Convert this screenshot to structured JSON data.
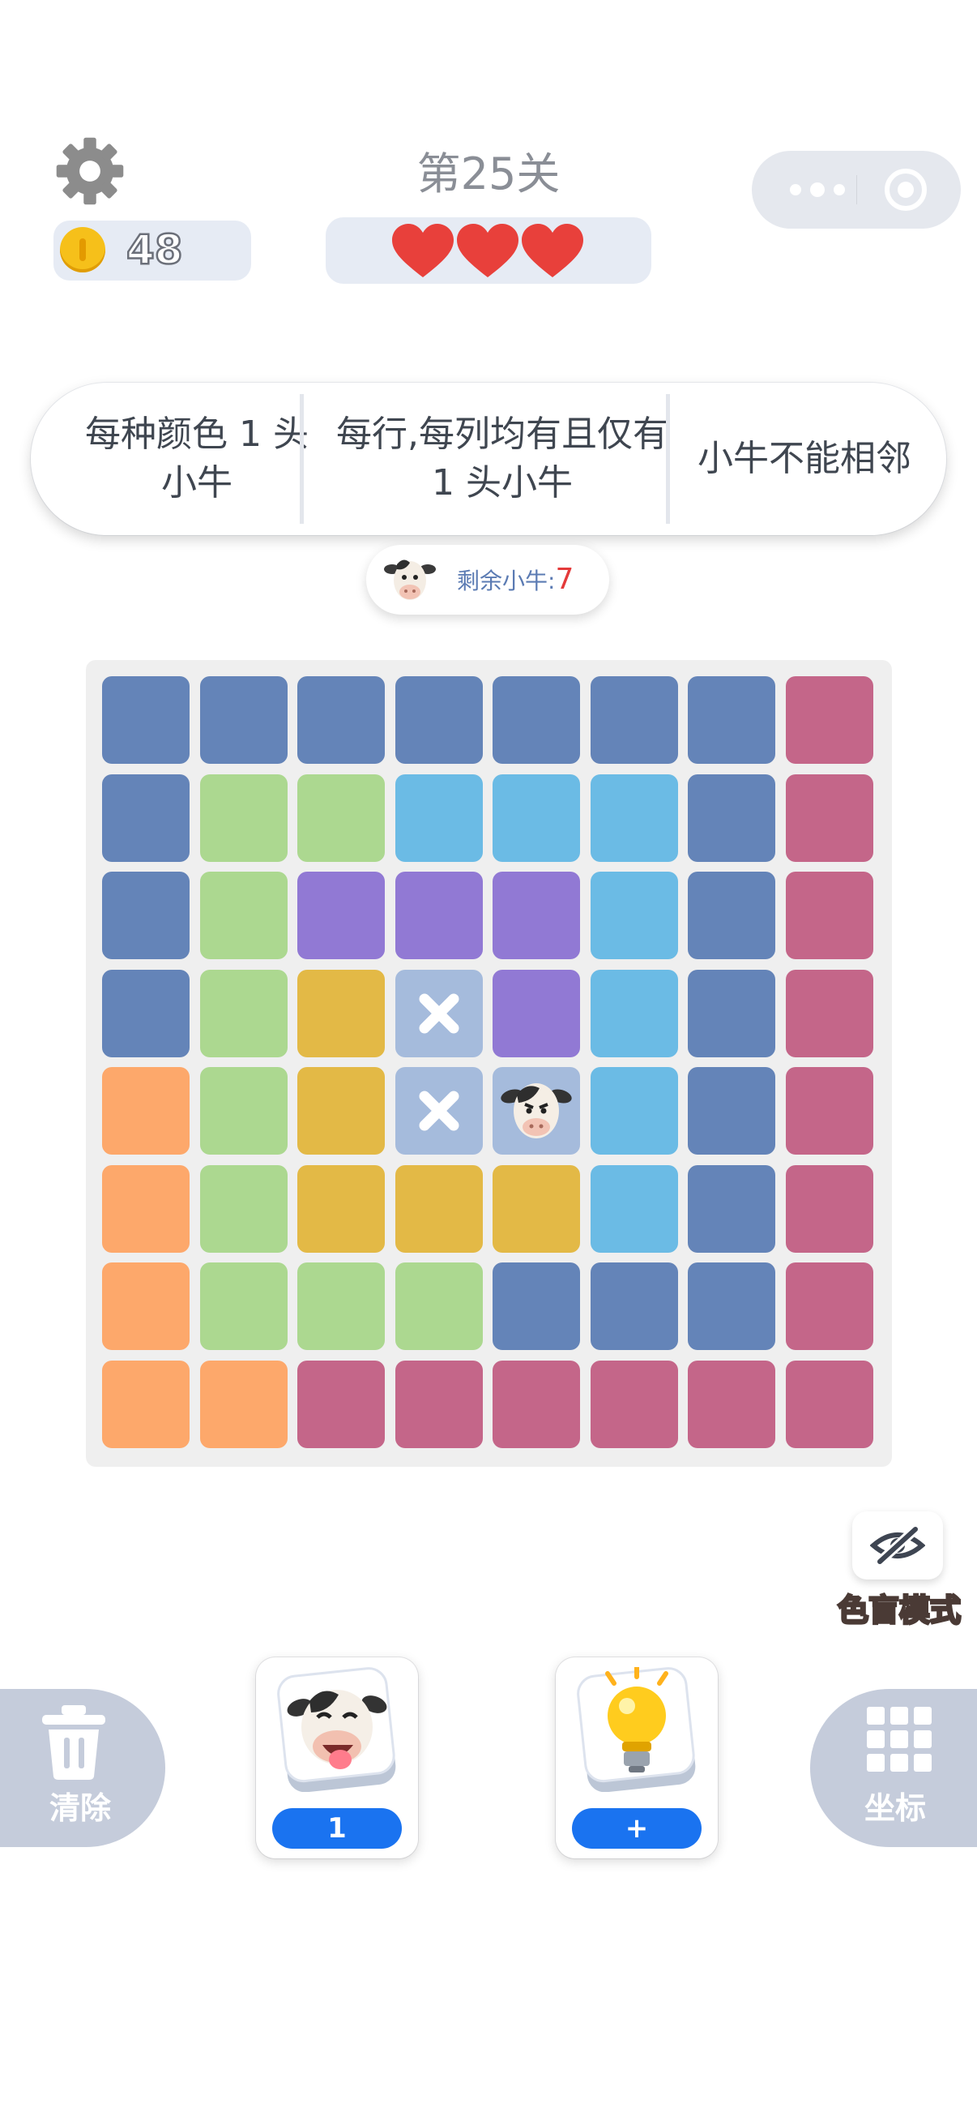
{
  "header": {
    "level_title": "第25关",
    "coins": "48",
    "lives": 3
  },
  "rules": [
    "每种颜色 1 头小牛",
    "每行,每列均有且仅有 1 头小牛",
    "小牛不能相邻"
  ],
  "remaining": {
    "label": "剩余小牛:",
    "count": "7"
  },
  "board": {
    "size": 8,
    "palette": {
      "B": "#6484b8",
      "P": "#c46689",
      "G": "#acd890",
      "C": "#6bbbe5",
      "V": "#9179d4",
      "Y": "#e3b946",
      "O": "#fda86b",
      "X": "#a5bbdc"
    },
    "rows": [
      [
        "B",
        "B",
        "B",
        "B",
        "B",
        "B",
        "B",
        "P"
      ],
      [
        "B",
        "G",
        "G",
        "C",
        "C",
        "C",
        "B",
        "P"
      ],
      [
        "B",
        "G",
        "V",
        "V",
        "V",
        "C",
        "B",
        "P"
      ],
      [
        "B",
        "G",
        "Y",
        "X",
        "V",
        "C",
        "B",
        "P"
      ],
      [
        "O",
        "G",
        "Y",
        "X",
        "X",
        "C",
        "B",
        "P"
      ],
      [
        "O",
        "G",
        "Y",
        "Y",
        "Y",
        "C",
        "B",
        "P"
      ],
      [
        "O",
        "G",
        "G",
        "G",
        "B",
        "B",
        "B",
        "P"
      ],
      [
        "O",
        "O",
        "P",
        "P",
        "P",
        "P",
        "P",
        "P"
      ]
    ],
    "marks": [
      {
        "row": 3,
        "col": 3,
        "kind": "x"
      },
      {
        "row": 4,
        "col": 3,
        "kind": "x"
      },
      {
        "row": 4,
        "col": 4,
        "kind": "cow"
      }
    ]
  },
  "colorblind": {
    "label": "色盲模式",
    "icon": "eye-off-icon"
  },
  "tools": {
    "clear_label": "清除",
    "coord_label": "坐标",
    "cow_hint_count": "1",
    "bulb_action": "+"
  }
}
